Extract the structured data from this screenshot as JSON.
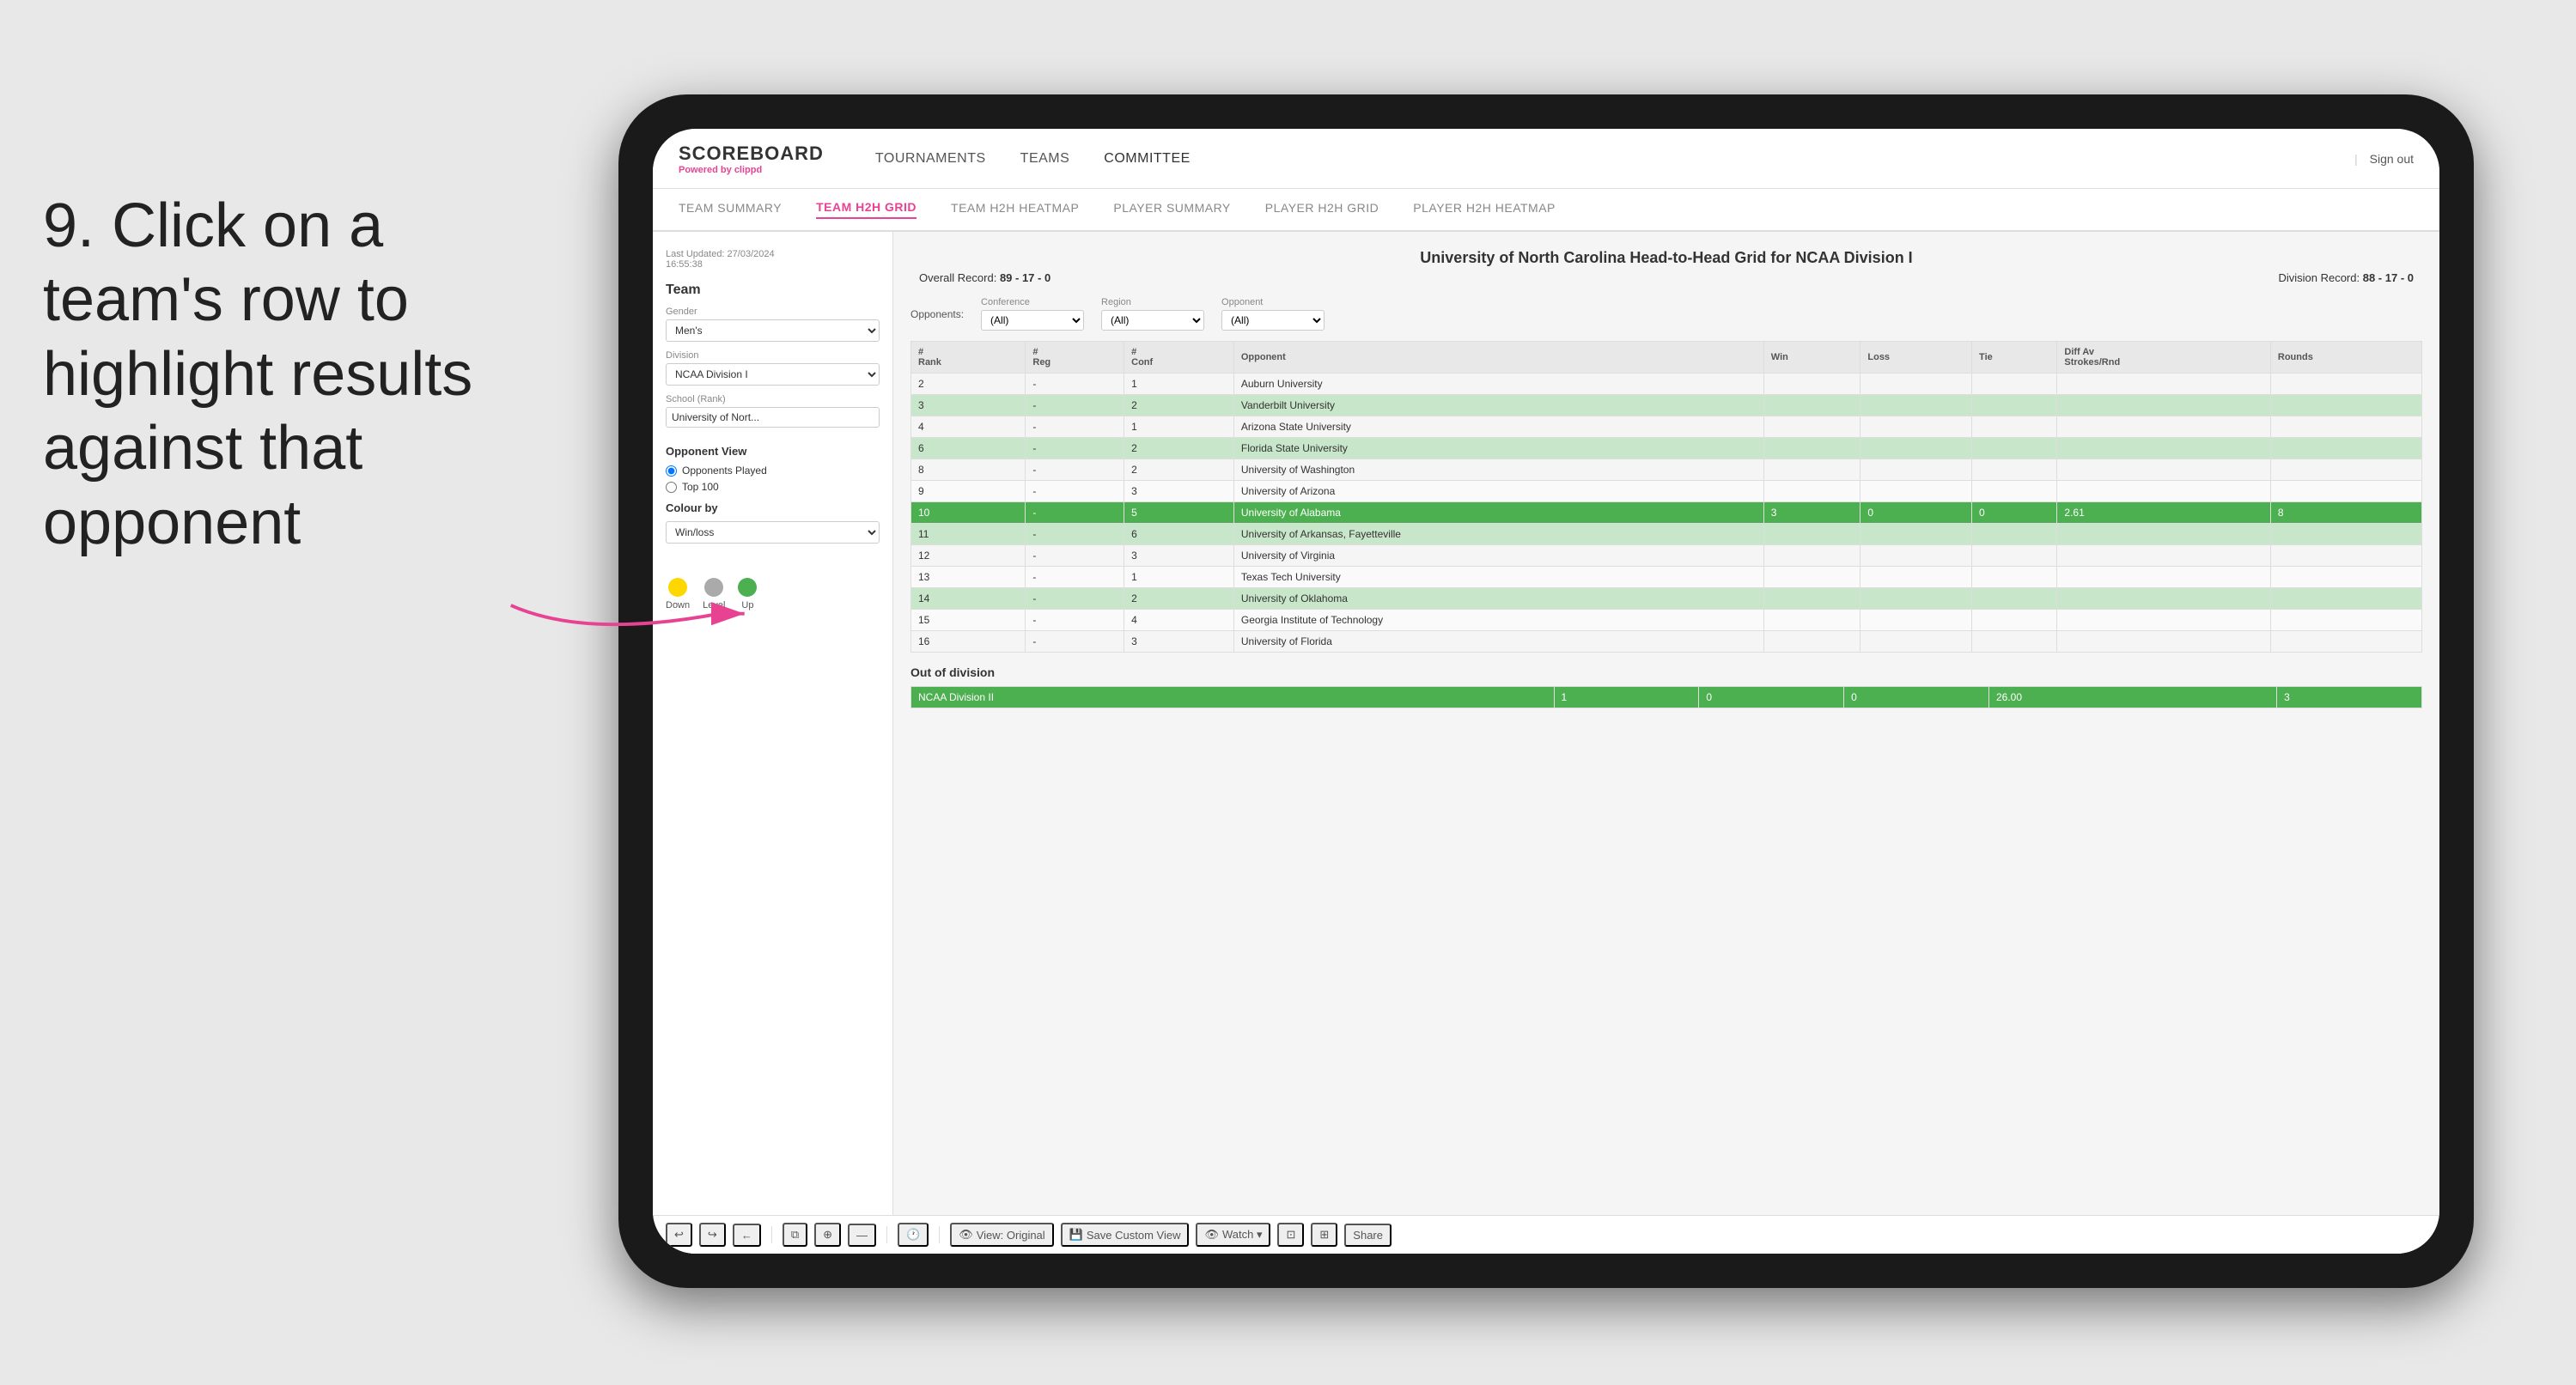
{
  "instruction": {
    "step_number": "9.",
    "text": "Click on a team's row to highlight results against that opponent"
  },
  "nav": {
    "logo": "SCOREBOARD",
    "powered_by": "Powered by",
    "powered_brand": "clippd",
    "items": [
      "TOURNAMENTS",
      "TEAMS",
      "COMMITTEE"
    ],
    "sign_out": "Sign out"
  },
  "sub_nav": {
    "items": [
      "TEAM SUMMARY",
      "TEAM H2H GRID",
      "TEAM H2H HEATMAP",
      "PLAYER SUMMARY",
      "PLAYER H2H GRID",
      "PLAYER H2H HEATMAP"
    ],
    "active": "TEAM H2H GRID"
  },
  "sidebar": {
    "last_updated_label": "Last Updated: 27/03/2024",
    "time": "16:55:38",
    "team_label": "Team",
    "gender_label": "Gender",
    "gender_value": "Men's",
    "division_label": "Division",
    "division_value": "NCAA Division I",
    "school_rank_label": "School (Rank)",
    "school_value": "University of Nort...",
    "opponent_view_label": "Opponent View",
    "opponents_played": "Opponents Played",
    "top100": "Top 100",
    "colour_by_label": "Colour by",
    "colour_by_value": "Win/loss",
    "legend": [
      {
        "label": "Down",
        "color": "#FFD700"
      },
      {
        "label": "Level",
        "color": "#AAAAAA"
      },
      {
        "label": "Up",
        "color": "#4CAF50"
      }
    ]
  },
  "main": {
    "title": "University of North Carolina Head-to-Head Grid for NCAA Division I",
    "overall_record_label": "Overall Record:",
    "overall_record": "89 - 17 - 0",
    "division_record_label": "Division Record:",
    "division_record": "88 - 17 - 0",
    "filters": {
      "opponents_label": "Opponents:",
      "conference_label": "Conference",
      "conference_value": "(All)",
      "region_label": "Region",
      "region_value": "(All)",
      "opponent_label": "Opponent",
      "opponent_value": "(All)"
    },
    "table_headers": [
      "#\nRank",
      "#\nReg",
      "#\nConf",
      "Opponent",
      "Win",
      "Loss",
      "Tie",
      "Diff Av\nStrokes/Rnd",
      "Rounds"
    ],
    "rows": [
      {
        "rank": "2",
        "reg": "-",
        "conf": "1",
        "opponent": "Auburn University",
        "win": "",
        "loss": "",
        "tie": "",
        "diff": "",
        "rounds": "",
        "style": ""
      },
      {
        "rank": "3",
        "reg": "-",
        "conf": "2",
        "opponent": "Vanderbilt University",
        "win": "",
        "loss": "",
        "tie": "",
        "diff": "",
        "rounds": "",
        "style": "light-green"
      },
      {
        "rank": "4",
        "reg": "-",
        "conf": "1",
        "opponent": "Arizona State University",
        "win": "",
        "loss": "",
        "tie": "",
        "diff": "",
        "rounds": "",
        "style": ""
      },
      {
        "rank": "6",
        "reg": "-",
        "conf": "2",
        "opponent": "Florida State University",
        "win": "",
        "loss": "",
        "tie": "",
        "diff": "",
        "rounds": "",
        "style": "light-green"
      },
      {
        "rank": "8",
        "reg": "-",
        "conf": "2",
        "opponent": "University of Washington",
        "win": "",
        "loss": "",
        "tie": "",
        "diff": "",
        "rounds": "",
        "style": ""
      },
      {
        "rank": "9",
        "reg": "-",
        "conf": "3",
        "opponent": "University of Arizona",
        "win": "",
        "loss": "",
        "tie": "",
        "diff": "",
        "rounds": "",
        "style": ""
      },
      {
        "rank": "10",
        "reg": "-",
        "conf": "5",
        "opponent": "University of Alabama",
        "win": "3",
        "loss": "0",
        "tie": "0",
        "diff": "2.61",
        "rounds": "8",
        "style": "selected"
      },
      {
        "rank": "11",
        "reg": "-",
        "conf": "6",
        "opponent": "University of Arkansas, Fayetteville",
        "win": "",
        "loss": "",
        "tie": "",
        "diff": "",
        "rounds": "",
        "style": "light-green"
      },
      {
        "rank": "12",
        "reg": "-",
        "conf": "3",
        "opponent": "University of Virginia",
        "win": "",
        "loss": "",
        "tie": "",
        "diff": "",
        "rounds": "",
        "style": ""
      },
      {
        "rank": "13",
        "reg": "-",
        "conf": "1",
        "opponent": "Texas Tech University",
        "win": "",
        "loss": "",
        "tie": "",
        "diff": "",
        "rounds": "",
        "style": ""
      },
      {
        "rank": "14",
        "reg": "-",
        "conf": "2",
        "opponent": "University of Oklahoma",
        "win": "",
        "loss": "",
        "tie": "",
        "diff": "",
        "rounds": "",
        "style": "light-green"
      },
      {
        "rank": "15",
        "reg": "-",
        "conf": "4",
        "opponent": "Georgia Institute of Technology",
        "win": "",
        "loss": "",
        "tie": "",
        "diff": "",
        "rounds": "",
        "style": ""
      },
      {
        "rank": "16",
        "reg": "-",
        "conf": "3",
        "opponent": "University of Florida",
        "win": "",
        "loss": "",
        "tie": "",
        "diff": "",
        "rounds": "",
        "style": ""
      }
    ],
    "out_of_division": {
      "label": "Out of division",
      "row": {
        "division": "NCAA Division II",
        "win": "1",
        "loss": "0",
        "tie": "0",
        "diff": "26.00",
        "rounds": "3",
        "style": "selected"
      }
    }
  },
  "toolbar": {
    "undo": "↩",
    "redo": "↪",
    "back": "←",
    "view_original": "View: Original",
    "save_custom": "Save Custom View",
    "watch": "Watch ▾",
    "share": "Share"
  }
}
